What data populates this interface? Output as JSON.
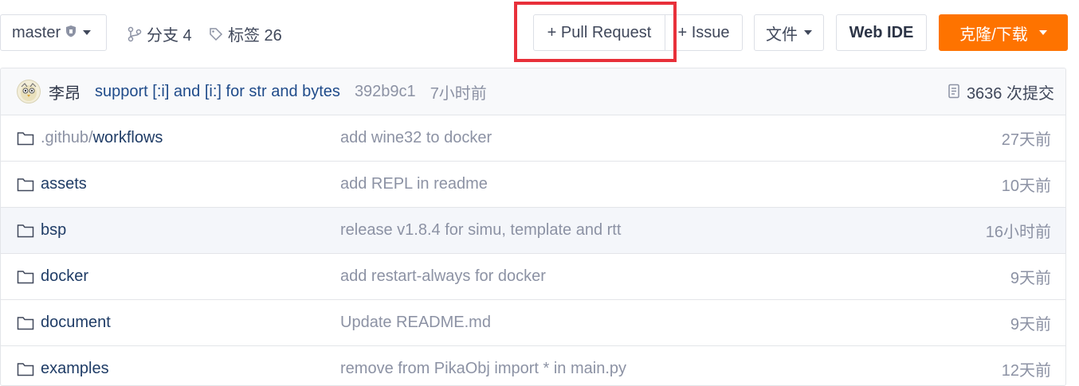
{
  "toolbar": {
    "branch": "master",
    "branches_label": "分支 4",
    "tags_label": "标签 26",
    "pull_request_label": "+ Pull Request",
    "issue_label": "+ Issue",
    "file_label": "文件",
    "web_ide_label": "Web IDE",
    "clone_label": "克隆/下载"
  },
  "commit": {
    "author": "李昂",
    "message": "support [:i] and [i:] for str and bytes",
    "sha": "392b9c1",
    "time": "7小时前",
    "count_label": "3636 次提交"
  },
  "files": [
    {
      "name_prefix": ".github/",
      "name_main": "workflows",
      "message": "add wine32 to docker",
      "time": "27天前"
    },
    {
      "name_prefix": "",
      "name_main": "assets",
      "message": "add REPL in readme",
      "time": "10天前"
    },
    {
      "name_prefix": "",
      "name_main": "bsp",
      "message": "release v1.8.4 for simu, template and rtt",
      "time": "16小时前"
    },
    {
      "name_prefix": "",
      "name_main": "docker",
      "message": "add restart-always for docker",
      "time": "9天前"
    },
    {
      "name_prefix": "",
      "name_main": "document",
      "message": "Update README.md",
      "time": "9天前"
    },
    {
      "name_prefix": "",
      "name_main": "examples",
      "message": "remove from PikaObj import * in main.py",
      "time": "12天前"
    }
  ],
  "colors": {
    "accent": "#fe7300",
    "highlight": "#e8303a",
    "link": "#1f3c66"
  }
}
